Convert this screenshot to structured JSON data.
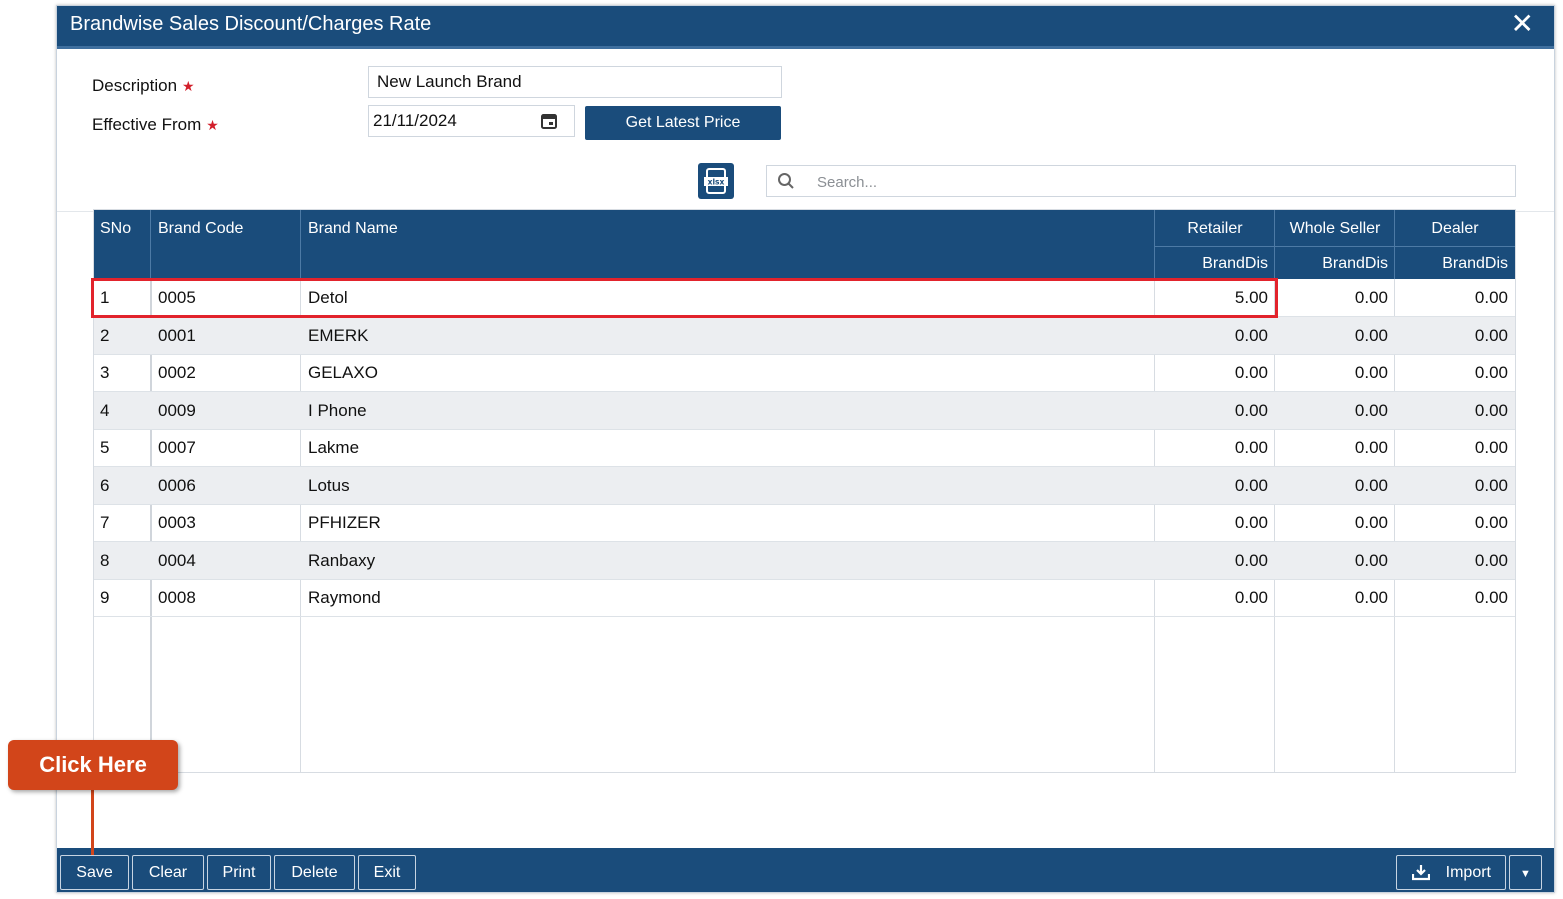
{
  "dialog": {
    "title": "Brandwise Sales Discount/Charges Rate",
    "close_icon": "close-icon"
  },
  "form": {
    "description_label": "Description",
    "effective_from_label": "Effective From",
    "required_mark": "★",
    "description_value": "New Launch Brand",
    "effective_from_value": "21/11/2024",
    "get_latest_price_label": "Get Latest Price",
    "search_placeholder": "Search..."
  },
  "table": {
    "headers": {
      "sno": "SNo",
      "brand_code": "Brand Code",
      "brand_name": "Brand Name",
      "retailer": "Retailer",
      "whole_seller": "Whole Seller",
      "dealer": "Dealer",
      "sub": "BrandDis"
    },
    "rows": [
      {
        "sno": "1",
        "code": "0005",
        "name": "Detol",
        "retailer": "5.00",
        "whole": "0.00",
        "dealer": "0.00"
      },
      {
        "sno": "2",
        "code": "0001",
        "name": "EMERK",
        "retailer": "0.00",
        "whole": "0.00",
        "dealer": "0.00"
      },
      {
        "sno": "3",
        "code": "0002",
        "name": "GELAXO",
        "retailer": "0.00",
        "whole": "0.00",
        "dealer": "0.00"
      },
      {
        "sno": "4",
        "code": "0009",
        "name": "I Phone",
        "retailer": "0.00",
        "whole": "0.00",
        "dealer": "0.00"
      },
      {
        "sno": "5",
        "code": "0007",
        "name": "Lakme",
        "retailer": "0.00",
        "whole": "0.00",
        "dealer": "0.00"
      },
      {
        "sno": "6",
        "code": "0006",
        "name": "Lotus",
        "retailer": "0.00",
        "whole": "0.00",
        "dealer": "0.00"
      },
      {
        "sno": "7",
        "code": "0003",
        "name": "PFHIZER",
        "retailer": "0.00",
        "whole": "0.00",
        "dealer": "0.00"
      },
      {
        "sno": "8",
        "code": "0004",
        "name": "Ranbaxy",
        "retailer": "0.00",
        "whole": "0.00",
        "dealer": "0.00"
      },
      {
        "sno": "9",
        "code": "0008",
        "name": "Raymond",
        "retailer": "0.00",
        "whole": "0.00",
        "dealer": "0.00"
      }
    ]
  },
  "footer": {
    "save": "Save",
    "clear": "Clear",
    "print": "Print",
    "delete": "Delete",
    "exit": "Exit",
    "import": "Import"
  },
  "callout": {
    "text": "Click Here"
  },
  "colors": {
    "primary": "#1a4c7b",
    "highlight": "#e2232c",
    "callout": "#d2451a"
  }
}
